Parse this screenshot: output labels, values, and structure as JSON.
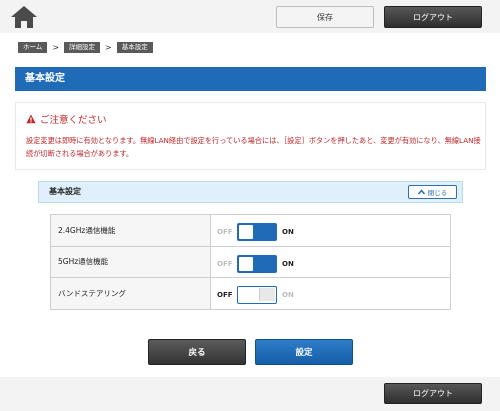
{
  "header": {
    "home_icon": "home-icon",
    "save_label": "保存",
    "logout_label": "ログアウト"
  },
  "breadcrumb": {
    "items": [
      "ホーム",
      "詳細設定",
      "基本設定"
    ],
    "separator": ">"
  },
  "page_title": "基本設定",
  "caution": {
    "icon": "warning-icon",
    "title": "ご注意ください",
    "text": "設定変更は即時に有効となります。無線LAN経由で設定を行っている場合には、［設定］ボタンを押したあと、変更が有効になり、無線LAN接続が切断される場合があります。",
    "color": "#c0262b"
  },
  "section": {
    "title": "基本設定",
    "close_label": "閉じる",
    "close_icon": "chevron-up-icon"
  },
  "settings": [
    {
      "label": "2.4GHz通信機能",
      "off_label": "OFF",
      "on_label": "ON",
      "state": "on"
    },
    {
      "label": "5GHz通信機能",
      "off_label": "OFF",
      "on_label": "ON",
      "state": "on"
    },
    {
      "label": "バンドステアリング",
      "off_label": "OFF",
      "on_label": "ON",
      "state": "off"
    }
  ],
  "actions": {
    "back_label": "戻る",
    "set_label": "設定"
  },
  "footer": {
    "logout_label": "ログアウト"
  },
  "colors": {
    "accent": "#1f6bb7",
    "title_bar": "#1f6bb7",
    "section_bg": "#dff0fa",
    "warning": "#c0262b"
  }
}
